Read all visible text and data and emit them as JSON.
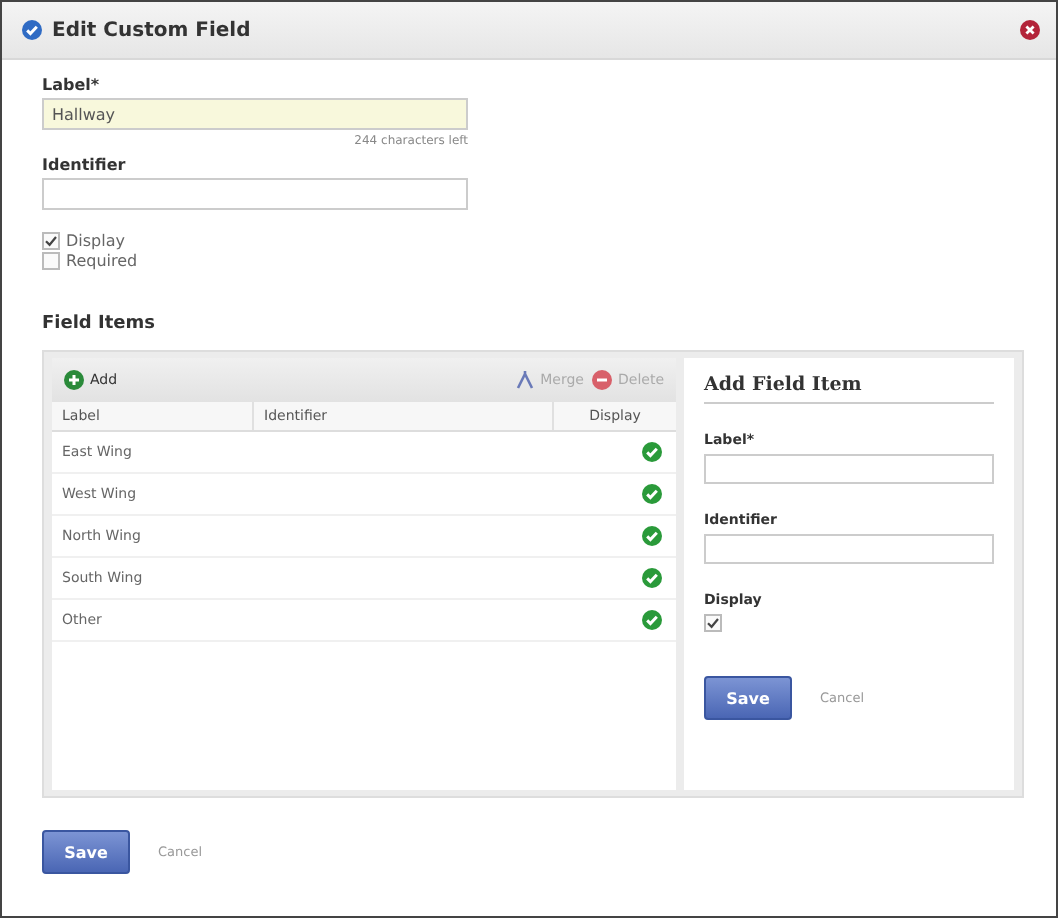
{
  "dialog": {
    "title": "Edit Custom Field"
  },
  "label_field": {
    "label": "Label*",
    "value": "Hallway",
    "hint": "244 characters left"
  },
  "identifier_field": {
    "label": "Identifier"
  },
  "options": [
    {
      "label": "Display",
      "checked": true
    },
    {
      "label": "Required",
      "checked": false
    }
  ],
  "field_items": {
    "heading": "Field Items",
    "toolbar": {
      "add": "Add",
      "merge": "Merge",
      "delete": "Delete"
    },
    "columns": [
      "Label",
      "Identifier",
      "Display"
    ],
    "rows": [
      {
        "label": "East Wing",
        "display": true
      },
      {
        "label": "West Wing",
        "display": true
      },
      {
        "label": "North Wing",
        "display": true
      },
      {
        "label": "South Wing",
        "display": true
      },
      {
        "label": "Other",
        "display": true
      }
    ]
  },
  "add_item": {
    "title": "Add Field Item",
    "label": "Label*",
    "identifier": "Identifier",
    "display_label": "Display",
    "display_checked": true,
    "save": "Save",
    "cancel": "Cancel"
  },
  "footer": {
    "save": "Save",
    "cancel": "Cancel"
  }
}
